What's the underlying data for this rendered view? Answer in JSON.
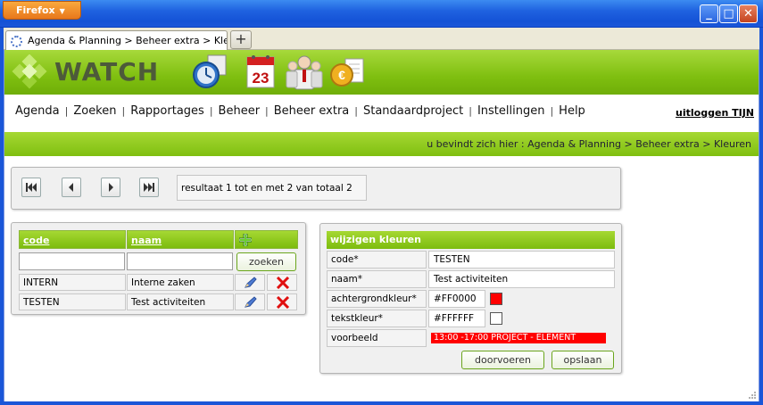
{
  "window": {
    "browser_button": "Firefox",
    "minimize": "_",
    "maximize": "□",
    "close": "✕"
  },
  "tab": {
    "title": "Agenda & Planning > Beheer extra > Kleuren",
    "new_tab": "+"
  },
  "header": {
    "logo_text": "WATCH"
  },
  "nav": {
    "items": [
      "Agenda",
      "Zoeken",
      "Rapportages",
      "Beheer",
      "Beheer extra",
      "Standaardproject",
      "Instellingen",
      "Help"
    ],
    "separator": "|",
    "logout": "uitloggen TIJN"
  },
  "breadcrumb": "u bevindt zich hier : Agenda & Planning > Beheer extra > Kleuren",
  "pager": {
    "info": "resultaat 1 tot en met 2 van totaal 2"
  },
  "list": {
    "headers": {
      "code": "code",
      "naam": "naam"
    },
    "search_button": "zoeken",
    "code_filter": "",
    "naam_filter": "",
    "rows": [
      {
        "code": "INTERN",
        "naam": "Interne zaken"
      },
      {
        "code": "TESTEN",
        "naam": "Test activiteiten"
      }
    ]
  },
  "edit": {
    "title": "wijzigen kleuren",
    "labels": {
      "code": "code*",
      "naam": "naam*",
      "bg": "achtergrondkleur*",
      "fg": "tekstkleur*",
      "preview": "voorbeeld"
    },
    "values": {
      "code": "TESTEN",
      "naam": "Test activiteiten",
      "bg": "#FF0000",
      "fg": "#FFFFFF",
      "preview": "13:00 -17:00 PROJECT - ELEMENT"
    },
    "buttons": {
      "apply": "doorvoeren",
      "save": "opslaan"
    }
  },
  "colors": {
    "accent": "#7fbf10",
    "bg_swatch": "#ff0000",
    "fg_swatch": "#ffffff"
  }
}
